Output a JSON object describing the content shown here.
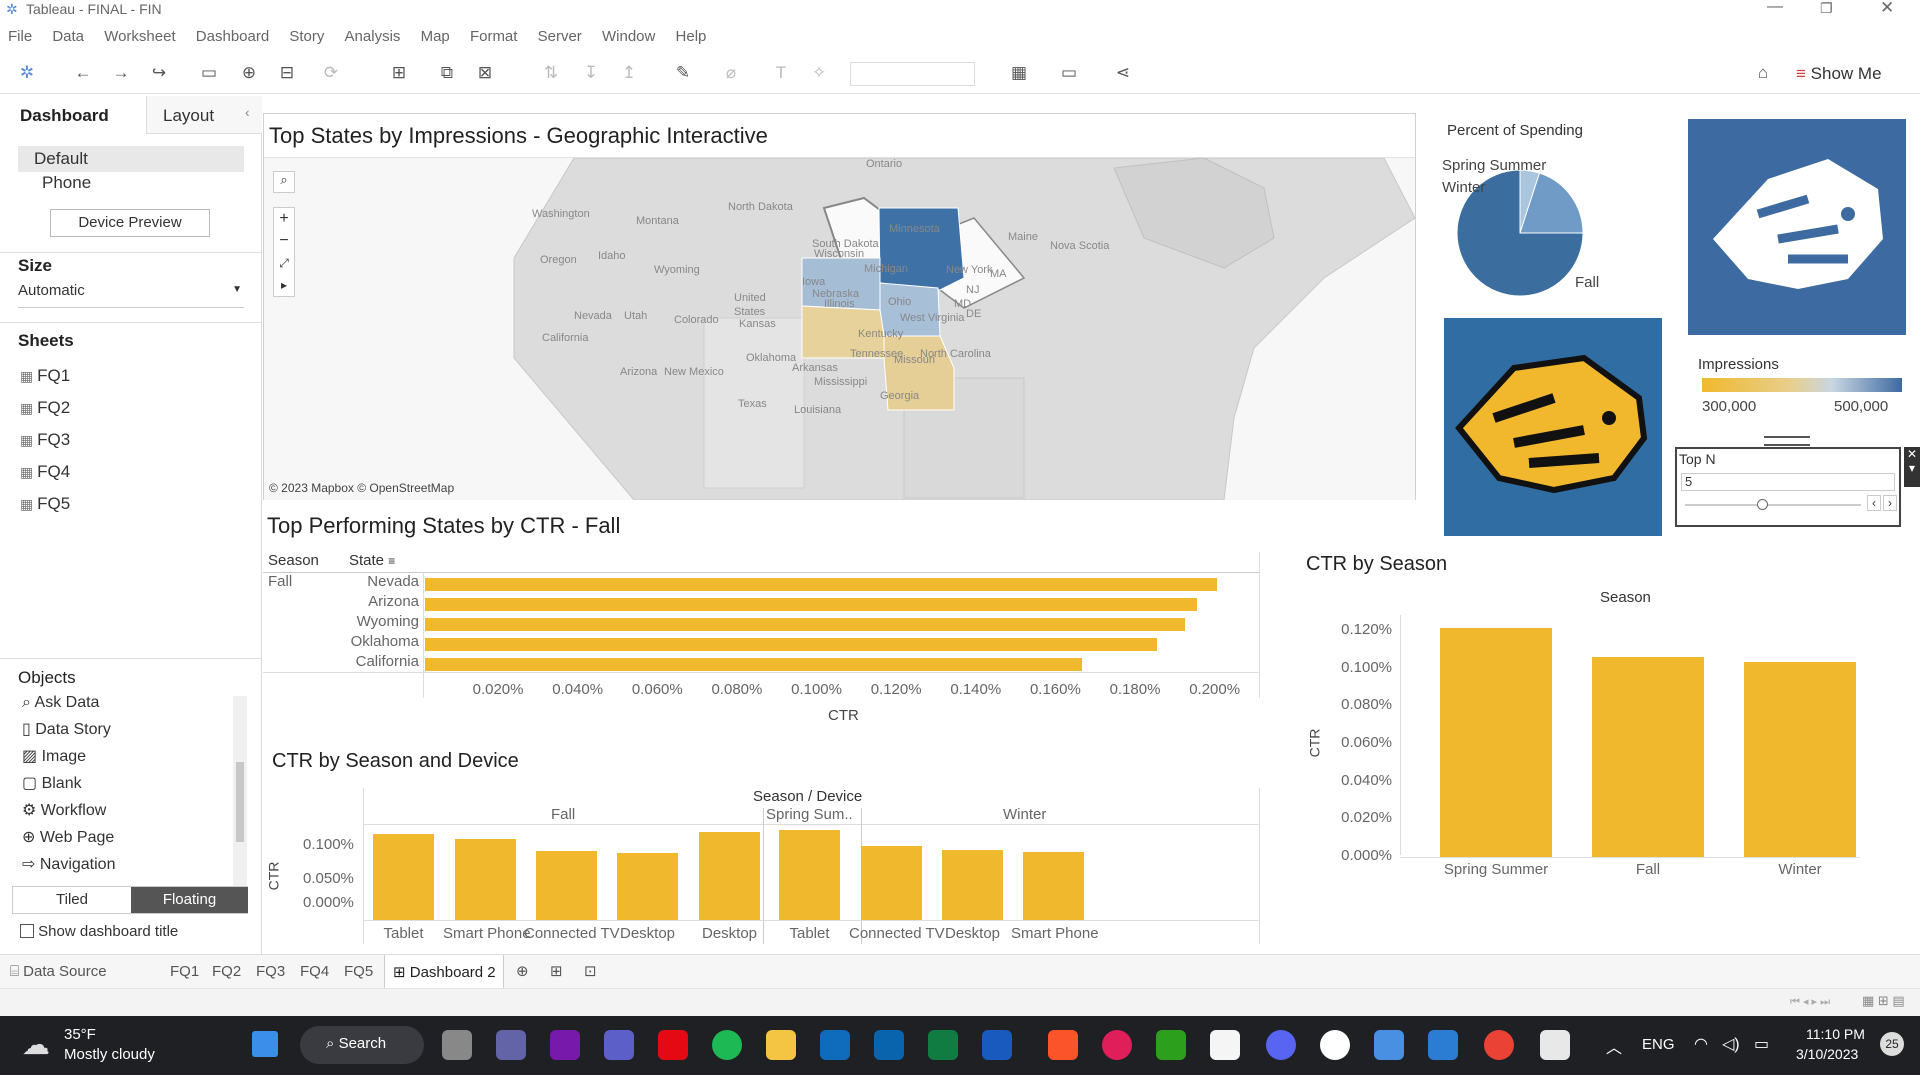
{
  "window": {
    "title": "Tableau - FINAL - FIN"
  },
  "menu": [
    "File",
    "Data",
    "Worksheet",
    "Dashboard",
    "Story",
    "Analysis",
    "Map",
    "Format",
    "Server",
    "Window",
    "Help"
  ],
  "toolbar": {
    "show_me": "Show Me"
  },
  "left": {
    "tab_dashboard": "Dashboard",
    "tab_layout": "Layout",
    "devices": [
      "Default",
      "Phone"
    ],
    "device_preview": "Device Preview",
    "size_label": "Size",
    "size_value": "Automatic",
    "sheets_label": "Sheets",
    "sheets": [
      "FQ1",
      "FQ2",
      "FQ3",
      "FQ4",
      "FQ5"
    ],
    "objects_label": "Objects",
    "objects": [
      "Ask Data",
      "Data Story",
      "Image",
      "Blank",
      "Workflow",
      "Web Page",
      "Navigation"
    ],
    "tiled": "Tiled",
    "floating": "Floating",
    "show_title": "Show dashboard title"
  },
  "map": {
    "title": "Top States by Impressions - Geographic Interactive",
    "credit": "© 2023 Mapbox © OpenStreetMap",
    "labels": [
      "Ontario",
      "Washington",
      "Montana",
      "North Dakota",
      "Oregon",
      "Idaho",
      "Wyoming",
      "Wisconsin",
      "Michigan",
      "Maine",
      "Nova Scotia",
      "New York",
      "Nevada",
      "Utah",
      "Colorado",
      "United",
      "States",
      "Kansas",
      "Illinois",
      "Ohio",
      "Iowa",
      "California",
      "Oklahoma",
      "Arkansas",
      "Kentucky",
      "West Virginia",
      "Tennessee",
      "North Carolina",
      "Arizona",
      "New Mexico",
      "Mississippi",
      "Texas",
      "Louisiana",
      "Georgia",
      "MD",
      "DE",
      "NJ",
      "MA",
      "South Dakota",
      "Nebraska",
      "Minnesota",
      "Missouri"
    ]
  },
  "pie": {
    "title": "Percent of Spending",
    "labels": [
      "Spring Summer",
      "Winter",
      "Fall"
    ],
    "colors": [
      "#a9c6de",
      "#6f9bc6",
      "#3b6e9f"
    ],
    "values": [
      0.05,
      0.2,
      0.75
    ]
  },
  "impressions_legend": {
    "title": "Impressions",
    "min": "300,000",
    "max": "500,000"
  },
  "topn": {
    "title": "Top N",
    "value": "5"
  },
  "ctr_state": {
    "title": "Top Performing States by CTR - Fall",
    "col_season": "Season",
    "col_state": "State",
    "season": "Fall",
    "axis_title": "CTR",
    "chart_data": {
      "type": "bar",
      "categories": [
        "Nevada",
        "Arizona",
        "Wyoming",
        "Oklahoma",
        "California"
      ],
      "values": [
        0.199,
        0.194,
        0.191,
        0.184,
        0.165
      ],
      "ticks": [
        "0.020%",
        "0.040%",
        "0.060%",
        "0.080%",
        "0.100%",
        "0.120%",
        "0.140%",
        "0.160%",
        "0.180%",
        "0.200%"
      ],
      "xlim": [
        0,
        0.21
      ]
    }
  },
  "ctr_device": {
    "title": "CTR by Season and Device",
    "header": "Season / Device",
    "groups": [
      "Fall",
      "Spring Sum..",
      "Winter"
    ],
    "ylabel": "CTR",
    "yticks": [
      "0.100%",
      "0.050%",
      "0.000%"
    ],
    "chart_data": {
      "type": "bar",
      "categories": [
        "Tablet",
        "Smart Phone",
        "Connected TV",
        "Desktop",
        "Desktop",
        "Tablet",
        "Connected TV",
        "Desktop",
        "Smart Phone"
      ],
      "values": [
        0.125,
        0.118,
        0.101,
        0.097,
        0.128,
        0.131,
        0.108,
        0.102,
        0.099
      ],
      "ylim": [
        0,
        0.14
      ]
    }
  },
  "ctr_season": {
    "title": "CTR by Season",
    "header": "Season",
    "ylabel": "CTR",
    "yticks": [
      "0.120%",
      "0.100%",
      "0.080%",
      "0.060%",
      "0.040%",
      "0.020%",
      "0.000%"
    ],
    "chart_data": {
      "type": "bar",
      "categories": [
        "Spring Summer",
        "Fall",
        "Winter"
      ],
      "values": [
        0.1215,
        0.1065,
        0.1035
      ],
      "ylim": [
        0,
        0.12
      ]
    }
  },
  "tabs": {
    "data_source": "Data Source",
    "sheets": [
      "FQ1",
      "FQ2",
      "FQ3",
      "FQ4",
      "FQ5"
    ],
    "active": "Dashboard 2"
  },
  "taskbar": {
    "weather_temp": "35°F",
    "weather_desc": "Mostly cloudy",
    "search": "Search",
    "lang": "ENG",
    "time": "11:10 PM",
    "date": "3/10/2023",
    "badge": "25"
  }
}
